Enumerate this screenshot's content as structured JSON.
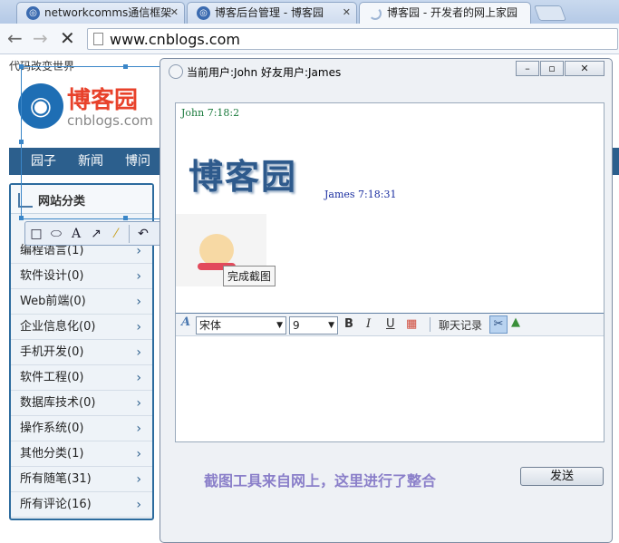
{
  "browser": {
    "tabs": [
      {
        "title": "networkcomms通信框架",
        "icon": "globe-icon"
      },
      {
        "title": "博客后台管理 - 博客园",
        "icon": "globe-icon"
      },
      {
        "title": "博客园 - 开发者的网上家园",
        "icon": "loading-spinner-icon"
      }
    ],
    "url": "www.cnblogs.com"
  },
  "page": {
    "tagline": "代码改变世界",
    "logo_title": "博客园",
    "logo_sub": "cnblogs.com",
    "nav": [
      "园子",
      "新闻",
      "博问"
    ],
    "category_title": "网站分类",
    "categories": [
      {
        "label": "编程语言(1)"
      },
      {
        "label": "软件设计(0)"
      },
      {
        "label": "Web前端(0)"
      },
      {
        "label": "企业信息化(0)"
      },
      {
        "label": "手机开发(0)"
      },
      {
        "label": "软件工程(0)"
      },
      {
        "label": "数据库技术(0)"
      },
      {
        "label": "操作系统(0)"
      },
      {
        "label": "其他分类(1)"
      },
      {
        "label": "所有随笔(31)"
      },
      {
        "label": "所有评论(16)"
      }
    ]
  },
  "capture": {
    "tooltip": "完成截图"
  },
  "chat": {
    "title": "当前用户:John  好友用户:James",
    "messages": [
      {
        "header": "John 7:18:2",
        "color": "#1a7a3c"
      },
      {
        "header": "James 7:18:31",
        "color": "#1a2ea0"
      }
    ],
    "big_text": "博客园",
    "font_name": "宋体",
    "font_size": "9",
    "history_label": "聊天记录",
    "footer_note": "截图工具来自网上，这里进行了整合",
    "send_label": "发送"
  }
}
